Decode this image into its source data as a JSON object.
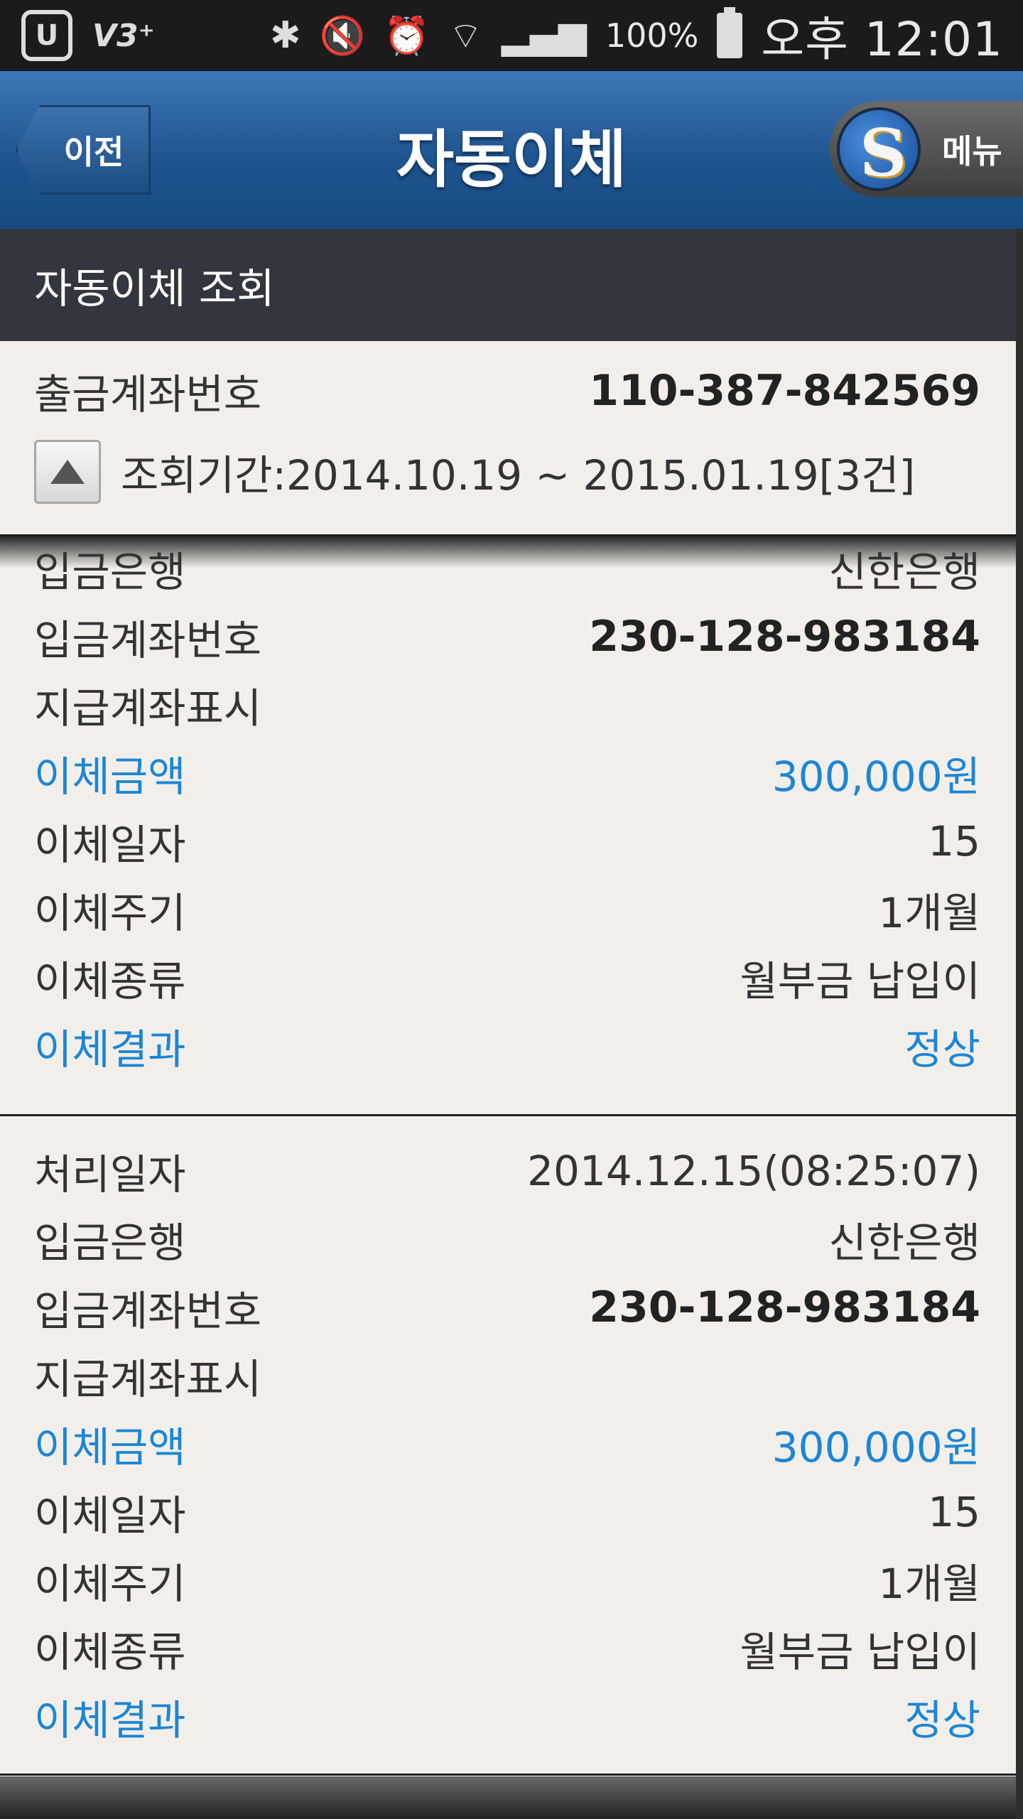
{
  "status_bar": {
    "left_icons": [
      "u-plus-icon",
      "v3-icon"
    ],
    "left_text": [
      "U",
      "V3"
    ],
    "battery": "100%",
    "time": "오후 12:01"
  },
  "header": {
    "back_label": "이전",
    "title": "자동이체",
    "menu_label": "메뉴"
  },
  "section": {
    "title": "자동이체 조회"
  },
  "query": {
    "account_label": "출금계좌번호",
    "account_value": "110-387-842569",
    "period_text": "조회기간:2014.10.19 ~ 2015.01.19[3건]"
  },
  "records": [
    {
      "rows": [
        {
          "label": "입금은행",
          "value": "신한은행"
        },
        {
          "label": "입금계좌번호",
          "value": "230-128-983184"
        },
        {
          "label": "지급계좌표시",
          "value": ""
        },
        {
          "label": "이체금액",
          "value": "300,000원"
        },
        {
          "label": "이체일자",
          "value": "15"
        },
        {
          "label": "이체주기",
          "value": "1개월"
        },
        {
          "label": "이체종류",
          "value": "월부금 납입이"
        },
        {
          "label": "이체결과",
          "value": "정상"
        }
      ]
    },
    {
      "rows": [
        {
          "label": "처리일자",
          "value": "2014.12.15(08:25:07)"
        },
        {
          "label": "입금은행",
          "value": "신한은행"
        },
        {
          "label": "입금계좌번호",
          "value": "230-128-983184"
        },
        {
          "label": "지급계좌표시",
          "value": ""
        },
        {
          "label": "이체금액",
          "value": "300,000원"
        },
        {
          "label": "이체일자",
          "value": "15"
        },
        {
          "label": "이체주기",
          "value": "1개월"
        },
        {
          "label": "이체종류",
          "value": "월부금 납입이"
        },
        {
          "label": "이체결과",
          "value": "정상"
        }
      ]
    }
  ],
  "colors": {
    "accent_blue": "#1c86d6",
    "header_blue": "#1e5590",
    "section_dark": "#34363f"
  }
}
